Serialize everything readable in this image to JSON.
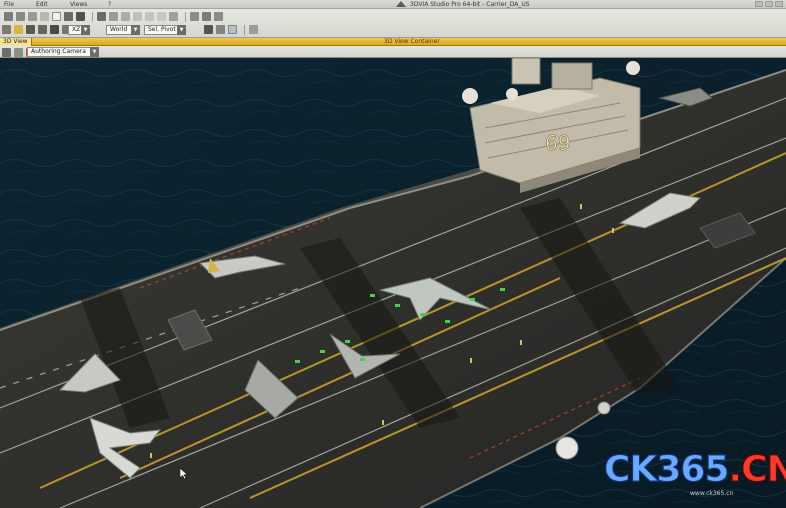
{
  "menu": {
    "items": [
      {
        "label": "File"
      },
      {
        "label": "Edit"
      },
      {
        "label": "Views"
      },
      {
        "label": "?"
      }
    ]
  },
  "window": {
    "title": "3DVIA Studio Pro 64-bit - Carrier_DA_US"
  },
  "toolbar": {
    "axis_combo": "XZ",
    "space_combo": "World",
    "pivot_combo": "Sel. Pivot"
  },
  "view": {
    "tab_label": "3D View",
    "container_title": "3D View Container",
    "camera_combo": "Authoring Camera"
  },
  "scene": {
    "hull_number": "69",
    "colors": {
      "sea": "#0e2430",
      "deck": "#2f2f2c",
      "deck_line_yellow": "#c9a227",
      "deck_line_white": "#d8d8d0",
      "island": "#bdb6a6",
      "selection_green": "#44d04a"
    }
  },
  "watermark": {
    "brand_left": "CK365",
    "brand_dot": ".",
    "brand_right": "CN",
    "sub": "www.ck365.cn"
  }
}
